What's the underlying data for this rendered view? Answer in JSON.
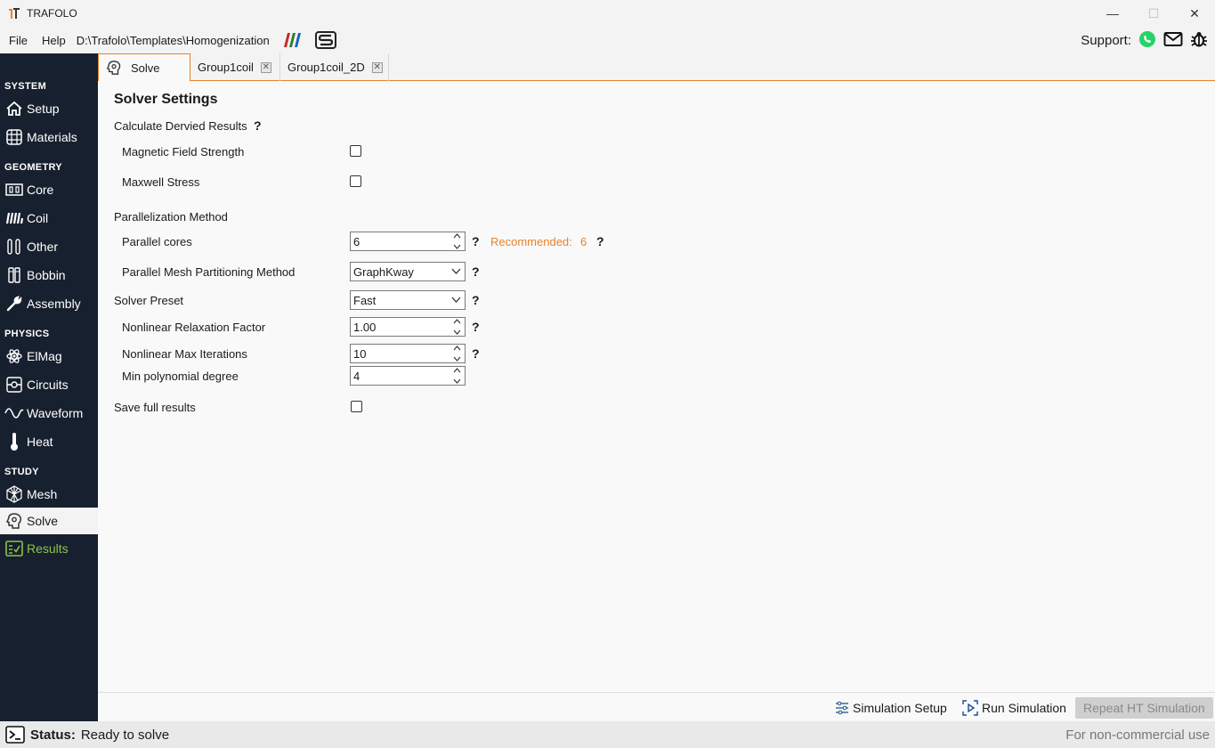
{
  "window": {
    "title": "TRAFOLO",
    "minimize": "—",
    "maximize": "☐",
    "close": "✕"
  },
  "menu": {
    "items": [
      "File",
      "Help"
    ],
    "path": "D:\\Trafolo\\Templates\\Homogenization",
    "support_label": "Support:"
  },
  "sidebar": {
    "sections": {
      "system": "SYSTEM",
      "geometry": "GEOMETRY",
      "physics": "PHYSICS",
      "study": "STUDY"
    },
    "items": [
      {
        "label": "Setup",
        "icon": "home-icon"
      },
      {
        "label": "Materials",
        "icon": "grid-globe-icon"
      },
      {
        "label": "Core",
        "icon": "core-icon"
      },
      {
        "label": "Coil",
        "icon": "coil-icon"
      },
      {
        "label": "Other",
        "icon": "other-icon"
      },
      {
        "label": "Bobbin",
        "icon": "bobbin-icon"
      },
      {
        "label": "Assembly",
        "icon": "wrench-icon"
      },
      {
        "label": "ElMag",
        "icon": "atom-icon"
      },
      {
        "label": "Circuits",
        "icon": "circuit-icon"
      },
      {
        "label": "Waveform",
        "icon": "sine-icon"
      },
      {
        "label": "Heat",
        "icon": "thermometer-icon"
      },
      {
        "label": "Mesh",
        "icon": "mesh-icon"
      },
      {
        "label": "Solve",
        "icon": "brain-gear-icon"
      },
      {
        "label": "Results",
        "icon": "results-icon"
      }
    ]
  },
  "tabs": [
    {
      "label": "Solve",
      "active": true
    },
    {
      "label": "Group1coil",
      "closable": true
    },
    {
      "label": "Group1coil_2D",
      "closable": true
    }
  ],
  "solver": {
    "heading": "Solver Settings",
    "derived_label": "Calculate Dervied Results",
    "magnetic_field_label": "Magnetic Field Strength",
    "magnetic_field_checked": false,
    "maxwell_stress_label": "Maxwell Stress",
    "maxwell_stress_checked": false,
    "parallelization_label": "Parallelization Method",
    "parallel_cores_label": "Parallel cores",
    "parallel_cores_value": "6",
    "recommended_label": "Recommended:",
    "recommended_value": "6",
    "partitioning_label": "Parallel Mesh Partitioning Method",
    "partitioning_value": "GraphKway",
    "preset_label": "Solver Preset",
    "preset_value": "Fast",
    "relaxation_label": "Nonlinear Relaxation Factor",
    "relaxation_value": "1.00",
    "max_iter_label": "Nonlinear Max Iterations",
    "max_iter_value": "10",
    "min_poly_label": "Min polynomial degree",
    "min_poly_value": "4",
    "save_full_label": "Save full results",
    "save_full_checked": false,
    "help": "?"
  },
  "toolbar": {
    "simulation_setup": "Simulation Setup",
    "run_simulation": "Run Simulation",
    "repeat_ht": "Repeat HT Simulation"
  },
  "status": {
    "label": "Status:",
    "text": "Ready to solve",
    "license": "For non-commercial use"
  },
  "colors": {
    "accent": "#e8832a",
    "sidebar_bg": "#17202e",
    "results_green": "#8bc34a"
  }
}
